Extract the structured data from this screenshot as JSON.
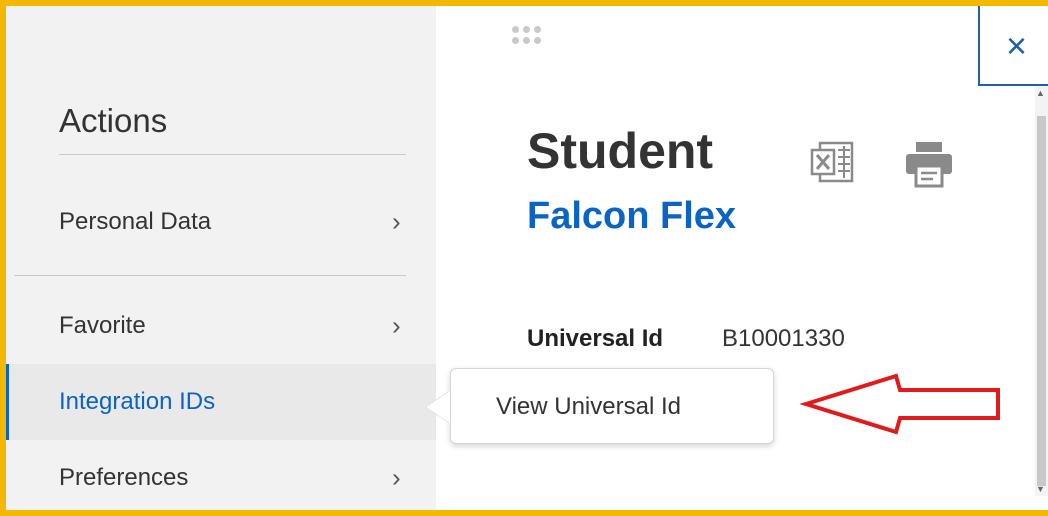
{
  "actions_panel": {
    "title": "Actions",
    "items": [
      {
        "label": "Personal Data",
        "chevron": "›"
      },
      {
        "label": "Favorite",
        "chevron": "›"
      },
      {
        "label": "Integration IDs",
        "chevron": ""
      },
      {
        "label": "Preferences",
        "chevron": "›"
      }
    ]
  },
  "popover": {
    "item_label": "View Universal Id"
  },
  "main": {
    "title": "Student",
    "subtitle": "Falcon Flex",
    "field_label": "Universal Id",
    "field_value": "B10001330",
    "close_label": "×",
    "excel_icon": "excel-export-icon",
    "print_icon": "printer-icon"
  },
  "colors": {
    "frame": "#f5b800",
    "link_blue": "#0b63c4",
    "annotation_red": "#e11b1b"
  }
}
